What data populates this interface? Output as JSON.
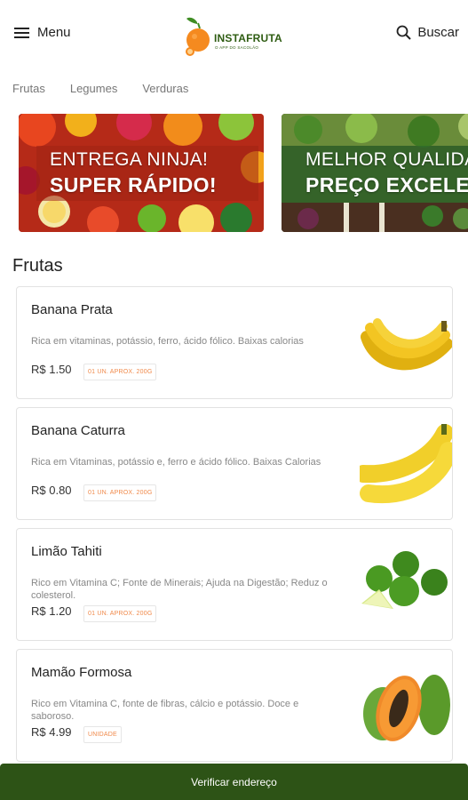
{
  "header": {
    "menu_label": "Menu",
    "search_label": "Buscar",
    "logo_text": "INSTAFRUTA",
    "logo_tagline": "O APP DO SACOLÃO"
  },
  "tabs": [
    "Frutas",
    "Legumes",
    "Verduras"
  ],
  "banners": [
    {
      "line1": "ENTREGA NINJA!",
      "line2": "SUPER RÁPIDO!"
    },
    {
      "line1": "MELHOR QUALIDADE",
      "line2": "PREÇO EXCELENTE"
    }
  ],
  "section": {
    "title": "Frutas"
  },
  "products": [
    {
      "name": "Banana Prata",
      "desc": "Rica em vitaminas, potássio, ferro, ácido fólico. Baixas calorias",
      "price": "R$ 1.50",
      "unit": "01 UN. APROX. 200G",
      "image": "banana-prata"
    },
    {
      "name": "Banana Caturra",
      "desc": "Rica em Vitaminas, potássio e, ferro e ácido fólico. Baixas Calorias",
      "price": "R$ 0.80",
      "unit": "01 UN. APROX. 200G",
      "image": "banana-caturra"
    },
    {
      "name": "Limão Tahiti",
      "desc": "Rico em Vitamina C; Fonte de Minerais; Ajuda na Digestão; Reduz o colesterol.",
      "price": "R$ 1.20",
      "unit": "01 UN. APROX. 200G",
      "image": "limao"
    },
    {
      "name": "Mamão Formosa",
      "desc": "Rico em Vitamina C, fonte de fibras, cálcio e potássio. Doce e saboroso.",
      "price": "R$ 4.99",
      "unit": "UNIDADE",
      "image": "mamao"
    }
  ],
  "bottom_bar": {
    "label": "Verificar endereço"
  },
  "colors": {
    "brand_green": "#2d5316",
    "badge_orange": "#f08a4b",
    "logo_orange": "#f58a1f"
  }
}
